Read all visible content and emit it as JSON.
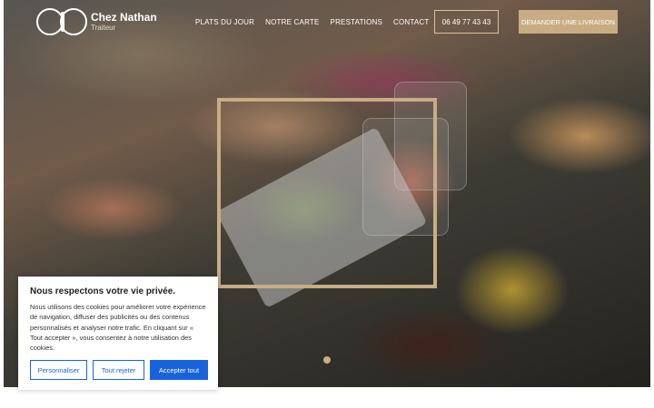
{
  "brand": {
    "name": "Chez Nathan",
    "tagline": "Traiteur"
  },
  "nav": {
    "items": [
      {
        "label": "PLATS DU JOUR"
      },
      {
        "label": "NOTRE CARTE"
      },
      {
        "label": "PRESTATIONS"
      },
      {
        "label": "CONTACT"
      }
    ]
  },
  "header": {
    "phone": "06 49 77 43 43",
    "delivery_label": "DEMANDER UNE LIVRAISON"
  },
  "cookie_banner": {
    "title": "Nous respectons votre vie privée.",
    "body": "Nous utilisons des cookies pour améliorer votre expérience de navigation, diffuser des publicités ou des contenus personnalisés et analyser notre trafic. En cliquant sur « Tout accepter », vous consentez à notre utilisation des cookies.",
    "customize_label": "Personnaliser",
    "reject_label": "Tout rejeter",
    "accept_label": "Accepter tout"
  },
  "colors": {
    "accent_gold": "#c8ad84",
    "cookie_blue": "#1863dc"
  }
}
